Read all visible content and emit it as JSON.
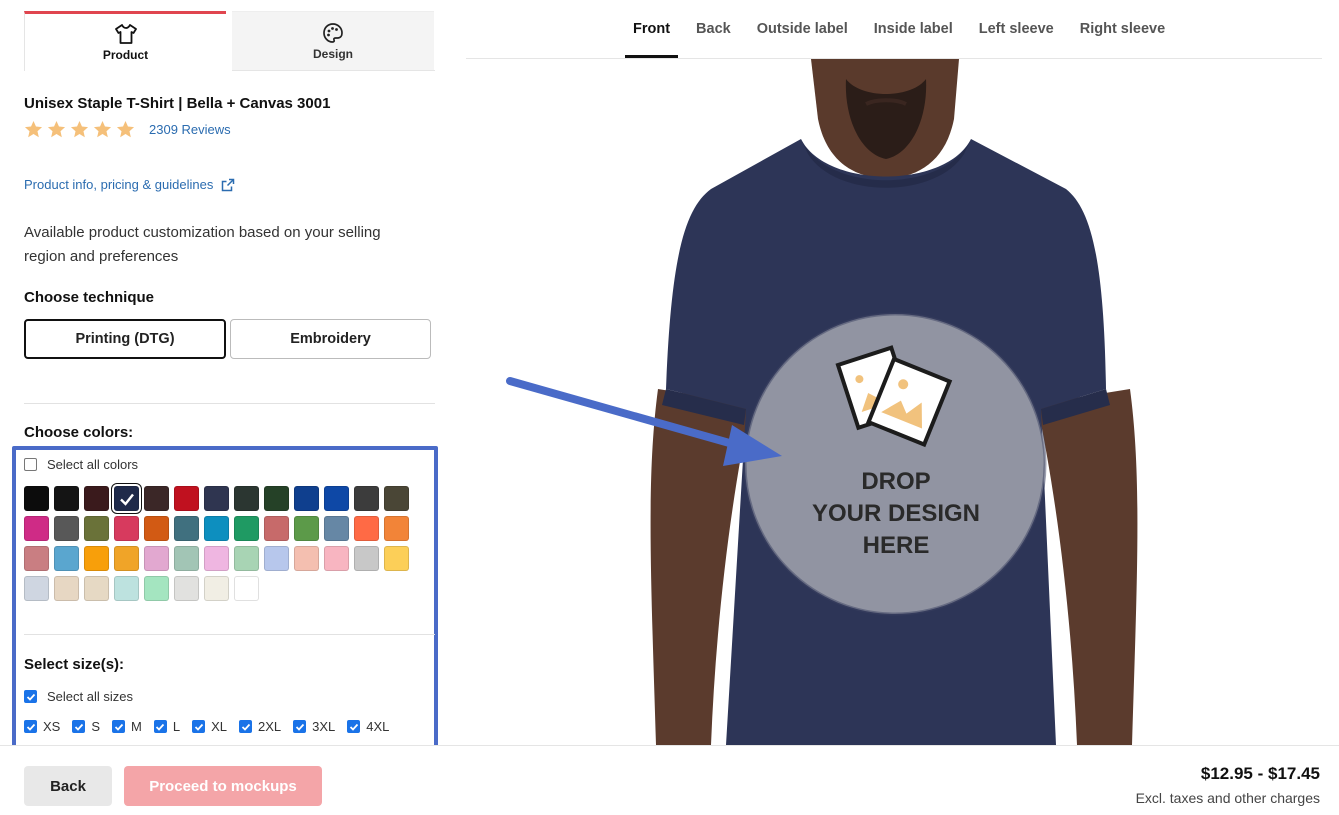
{
  "tabs": {
    "product": "Product",
    "design": "Design"
  },
  "product": {
    "title": "Unisex Staple T-Shirt | Bella + Canvas 3001",
    "reviews": "2309 Reviews",
    "rating": 5,
    "info_link": "Product info, pricing & guidelines",
    "availability": "Available product customization based on your selling region and preferences"
  },
  "technique": {
    "title": "Choose technique",
    "options": [
      "Printing (DTG)",
      "Embroidery"
    ],
    "selected": "Printing (DTG)"
  },
  "colors": {
    "title": "Choose colors:",
    "select_all": "Select all colors",
    "swatches": [
      "#0c0c0c",
      "#141414",
      "#3a1a1c",
      "#1f2a4a",
      "#3b2727",
      "#c0111f",
      "#2f3550",
      "#2b3631",
      "#254127",
      "#0f3f8e",
      "#0e48a6",
      "#3c3c3c",
      "#4a4636",
      "#cf2b86",
      "#585858",
      "#6a7239",
      "#d73a5e",
      "#d25a14",
      "#40707f",
      "#0d8fbf",
      "#1f9a63",
      "#c76a6a",
      "#5c9a49",
      "#6687a5",
      "#ff6a45",
      "#f28438",
      "#c97e82",
      "#5aa6cf",
      "#f89f0a",
      "#f0a428",
      "#e2a8d0",
      "#a2c5b5",
      "#efb6e1",
      "#a8d4b4",
      "#b7c7ec",
      "#f4bfb0",
      "#f8b5c1",
      "#c8c8c8",
      "#fccf58",
      "#cfd6e1",
      "#e7d7c3",
      "#e6d9c4",
      "#bde2df",
      "#a4e5c0",
      "#e1e1df",
      "#f1eee4",
      "#ffffff"
    ],
    "selected_index": 3
  },
  "sizes": {
    "title": "Select size(s):",
    "select_all": "Select all sizes",
    "list": [
      "XS",
      "S",
      "M",
      "L",
      "XL",
      "2XL",
      "3XL",
      "4XL"
    ]
  },
  "footer": {
    "back": "Back",
    "proceed": "Proceed to mockups",
    "price": "$12.95 - $17.45",
    "price_note": "Excl. taxes and other charges"
  },
  "view_tabs": [
    "Front",
    "Back",
    "Outside label",
    "Inside label",
    "Left sleeve",
    "Right sleeve"
  ],
  "active_view": "Front",
  "drop_zone": {
    "text": "DROP\nYOUR DESIGN\nHERE"
  },
  "accent_color": "#e0454f",
  "highlight_color": "#4a6bc8",
  "link_color": "#2b6cb0"
}
